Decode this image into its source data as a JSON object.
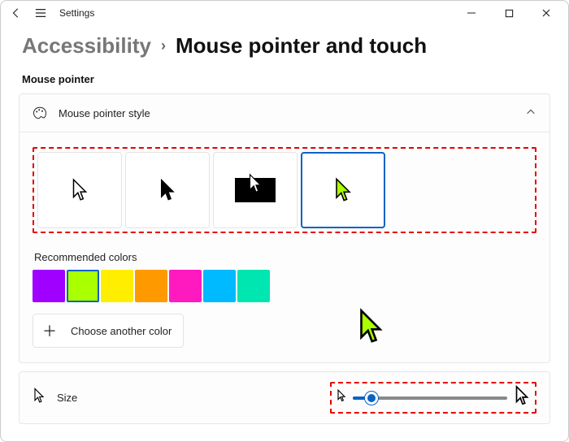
{
  "titlebar": {
    "app_name": "Settings"
  },
  "breadcrumb": {
    "parent": "Accessibility",
    "current": "Mouse pointer and touch"
  },
  "section_label": "Mouse pointer",
  "expander": {
    "title": "Mouse pointer style",
    "selected_index": 3
  },
  "recommended": {
    "label": "Recommended colors",
    "colors": [
      "#a000ff",
      "#aaff00",
      "#ffee00",
      "#ff9900",
      "#ff1abf",
      "#00baff",
      "#00e6b0"
    ],
    "selected_index": 1
  },
  "choose_another": {
    "label": "Choose another color"
  },
  "size": {
    "label": "Size",
    "slider_percent": 12
  }
}
